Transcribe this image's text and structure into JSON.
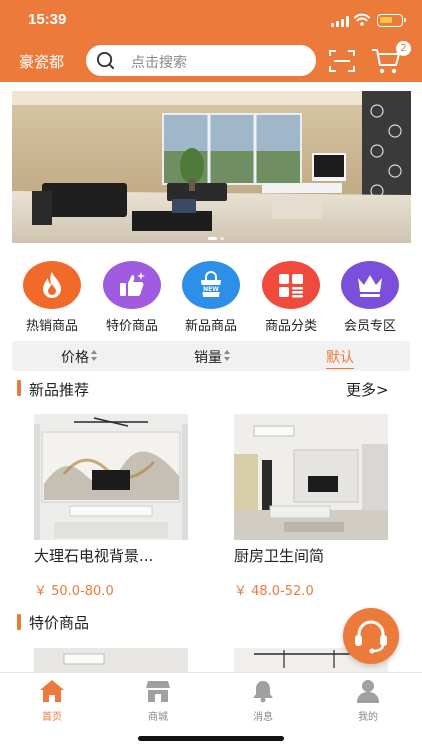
{
  "status_bar": {
    "time": "15:39"
  },
  "header": {
    "brand": "豪瓷都",
    "search_placeholder": "点击搜索",
    "cart_badge": "2"
  },
  "categories": [
    {
      "label": "热销商品",
      "icon": "flame-icon",
      "color": "#f26a2a"
    },
    {
      "label": "特价商品",
      "icon": "thumbs-up-icon",
      "color": "#a05be0"
    },
    {
      "label": "新品商品",
      "icon": "new-bag-icon",
      "color": "#2e8fe8"
    },
    {
      "label": "商品分类",
      "icon": "grid-list-icon",
      "color": "#f04a3c"
    },
    {
      "label": "会员专区",
      "icon": "crown-icon",
      "color": "#7a4fdc"
    }
  ],
  "sort_bar": {
    "price": "价格",
    "sales": "销量",
    "default": "默认"
  },
  "new_products": {
    "title": "新品推荐",
    "more": "更多>",
    "items": [
      {
        "name": "大理石电视背景...",
        "price": "￥ 50.0-80.0"
      },
      {
        "name": "厨房卫生间简",
        "price": "￥ 48.0-52.0"
      }
    ]
  },
  "special_products": {
    "title": "特价商品"
  },
  "tabbar": [
    {
      "label": "首页",
      "icon": "home-icon",
      "active": true
    },
    {
      "label": "商城",
      "icon": "store-icon",
      "active": false
    },
    {
      "label": "消息",
      "icon": "bell-icon",
      "active": false
    },
    {
      "label": "我的",
      "icon": "user-icon",
      "active": false
    }
  ],
  "colors": {
    "accent": "#ec7b3b",
    "tab_inactive": "#888888",
    "price": "#ec7b3b"
  }
}
